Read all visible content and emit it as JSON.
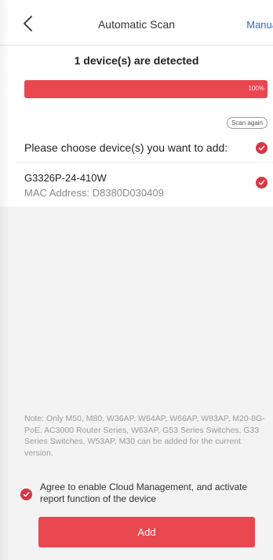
{
  "header": {
    "title": "Automatic Scan",
    "manual_label": "Manua"
  },
  "scan": {
    "detected_text": "1 device(s) are detected",
    "progress_label": "100%",
    "progress_fraction": 1.0,
    "scan_again_label": "Scan again"
  },
  "choose": {
    "label": "Please choose device(s) you want to add:"
  },
  "devices": [
    {
      "name": "G3326P-24-410W",
      "mac_label": "MAC Address:",
      "mac_value": "D8380D030409",
      "selected": true
    }
  ],
  "note": {
    "text": "Note: Only M50, M80, W36AP, W64AP, W66AP, W83AP, M20-8G-PoE, AC3000 Router Series, W63AP, G53 Series Switches, G33 Series Switches, W53AP, M30 can be added for the current version."
  },
  "agree": {
    "text": "Agree to enable Cloud Management, and activate report function of the device"
  },
  "actions": {
    "add_label": "Add"
  },
  "colors": {
    "accent": "#e8474f",
    "check": "#d93542",
    "link": "#2f6fc4"
  }
}
